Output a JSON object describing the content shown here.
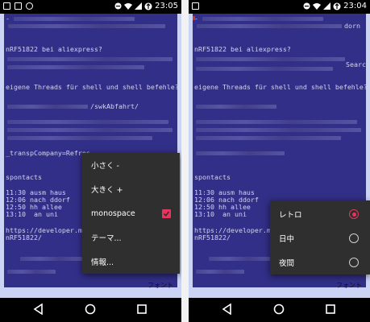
{
  "left": {
    "status_time": "23:05",
    "lines": [
      "-",
      "nRF51822 bei aliexpress?",
      "eigene Threads für shell und shell befehle?",
      "/swkAbfahrt/",
      "_transpCompany=Refres",
      "spontacts",
      "11:30 ausm haus",
      "12:06 nach ddorf",
      "12:50 hh allee",
      "13:10  an uni",
      "https://developer.mba",
      "nRF51822/"
    ],
    "menu_items": [
      {
        "label": "小さく -"
      },
      {
        "label": "大きく +"
      },
      {
        "label": "monospace",
        "checked": true
      },
      {
        "label": "テーマ..."
      },
      {
        "label": "情報..."
      }
    ],
    "font_label": "フォント"
  },
  "right": {
    "status_time": "23:04",
    "lines": [
      "-",
      "dorn",
      "nRF51822 bei aliexpress?",
      "Searc",
      "eigene Threads für shell und shell befehle?",
      "spontacts",
      "11:30 ausm haus",
      "12:06 nach ddorf",
      "12:50 hh allee",
      "13:10  an uni",
      "https://developer.mba",
      "nRF51822/"
    ],
    "theme_options": [
      {
        "label": "レトロ",
        "selected": true
      },
      {
        "label": "日中",
        "selected": false
      },
      {
        "label": "夜間",
        "selected": false
      }
    ],
    "font_label": "フォント"
  },
  "colors": {
    "note_bg": "#322f88",
    "screen_bg": "#cbd4f5",
    "menu_bg": "#2f2f2f",
    "accent": "#e8345f",
    "text": "#d3d3f0"
  },
  "icons": [
    "notification-icon",
    "image-icon",
    "circle-outline-icon",
    "minus-circle-icon",
    "wifi-icon",
    "signal-icon",
    "battery-icon",
    "data-saver-icon",
    "back-icon",
    "home-icon",
    "recents-icon"
  ]
}
